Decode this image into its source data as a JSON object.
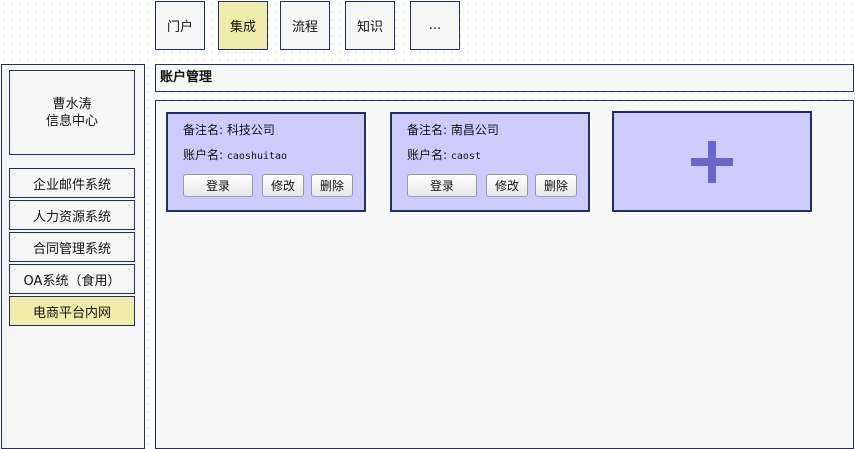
{
  "top_tabs": [
    {
      "label": "门户",
      "active": false
    },
    {
      "label": "集成",
      "active": true
    },
    {
      "label": "流程",
      "active": false
    },
    {
      "label": "知识",
      "active": false
    },
    {
      "label": "...",
      "active": false
    }
  ],
  "user": {
    "name": "曹水涛",
    "center": "信息中心"
  },
  "sidebar": {
    "items": [
      {
        "label": "企业邮件系统",
        "active": false
      },
      {
        "label": "人力资源系统",
        "active": false
      },
      {
        "label": "合同管理系统",
        "active": false
      },
      {
        "label": "OA系统（食用）",
        "active": false
      },
      {
        "label": "电商平台内网",
        "active": true
      }
    ]
  },
  "main": {
    "title": "账户管理",
    "accounts": [
      {
        "remark_label": "备注名:",
        "remark": "科技公司",
        "account_label": "账户名:",
        "account": "caoshuitao",
        "login_label": "登录",
        "edit_label": "修改",
        "delete_label": "删除"
      },
      {
        "remark_label": "备注名:",
        "remark": "南昌公司",
        "account_label": "账户名:",
        "account": "caost",
        "login_label": "登录",
        "edit_label": "修改",
        "delete_label": "删除"
      }
    ],
    "add_card_icon": "plus-icon"
  },
  "colors": {
    "border": "#1e2f6a",
    "panel": "#f7f7f7",
    "active": "#eeeeaa",
    "card": "#ccccff",
    "plus": "#6666cc"
  }
}
